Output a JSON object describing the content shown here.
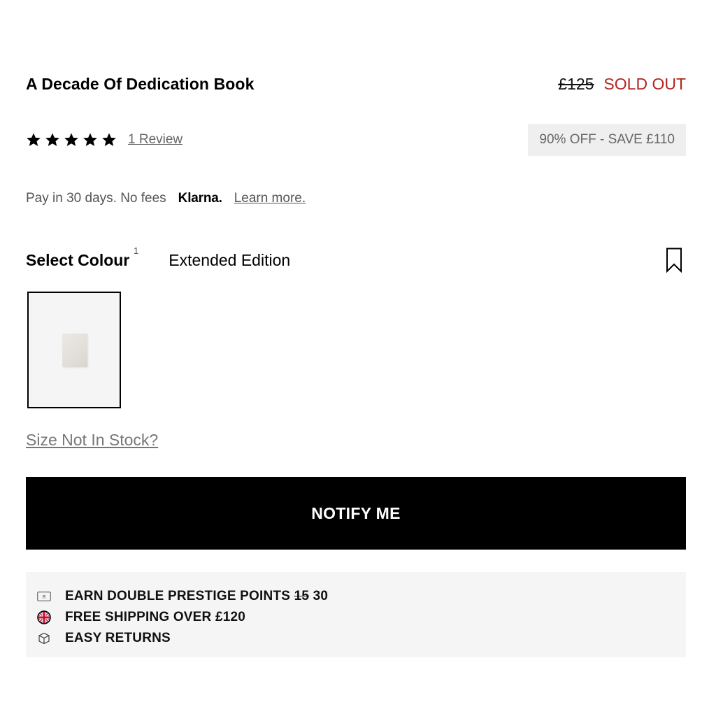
{
  "product": {
    "title": "A Decade Of Dedication Book",
    "old_price": "£125",
    "status": "SOLD OUT",
    "status_color": "#b3261e"
  },
  "rating": {
    "stars": 5,
    "review_link": "1 Review"
  },
  "discount_badge": "90% OFF - SAVE £110",
  "klarna": {
    "pay_text": "Pay in 30 days. No fees",
    "logo_text": "Klarna.",
    "learn_more": "Learn more."
  },
  "colour": {
    "label": "Select Colour",
    "count": "1",
    "selected": "Extended Edition",
    "bookmark_icon": "bookmark-icon"
  },
  "size_link": "Size Not In Stock?",
  "notify_button": "NOTIFY ME",
  "perks": {
    "points_prefix": "EARN DOUBLE PRESTIGE POINTS",
    "points_old": "15",
    "points_new": "30",
    "shipping": "FREE SHIPPING OVER £120",
    "returns": "EASY RETURNS",
    "icons": [
      "rewards-card-icon",
      "uk-flag-icon",
      "box-icon"
    ]
  }
}
